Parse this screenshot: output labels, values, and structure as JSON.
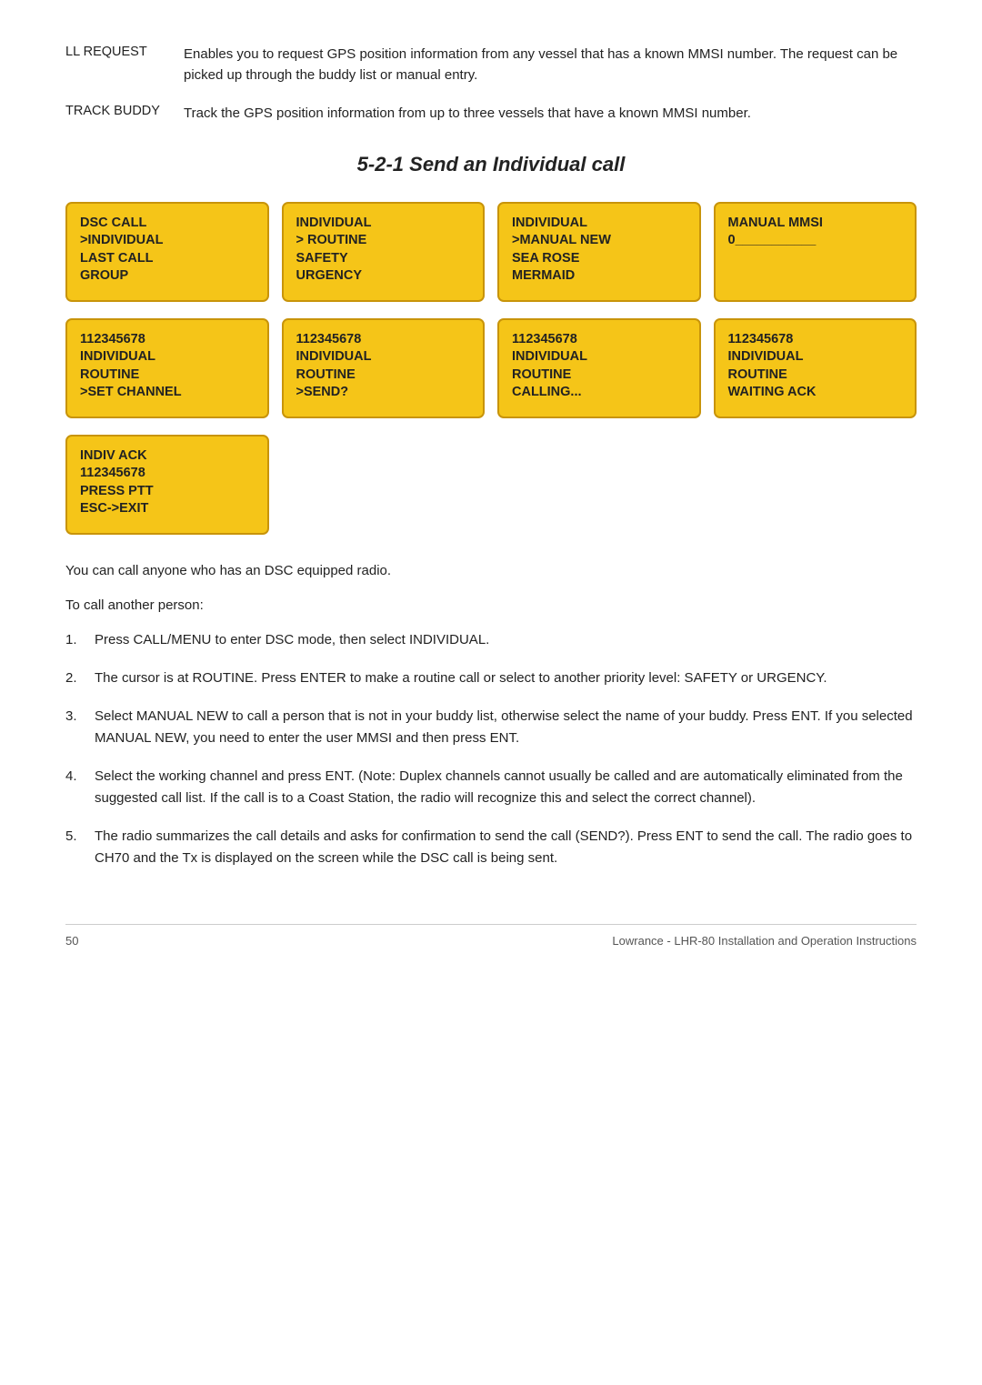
{
  "definitions": [
    {
      "term": "LL REQUEST",
      "body": "Enables you to request GPS position information from any vessel that has a known MMSI number. The request can be picked up through the buddy list or manual entry."
    },
    {
      "term": "TRACK BUDDY",
      "body": "Track the GPS position information from up to three vessels that have a known MMSI number."
    }
  ],
  "section_title": "5-2-1 Send an Individual call",
  "row1": [
    {
      "lines": [
        "DSC CALL",
        ">INDIVIDUAL",
        "LAST CALL",
        "GROUP"
      ]
    },
    {
      "lines": [
        "INDIVIDUAL",
        "> ROUTINE",
        "SAFETY",
        "URGENCY"
      ]
    },
    {
      "lines": [
        "INDIVIDUAL",
        ">MANUAL NEW",
        "SEA ROSE",
        "MERMAID"
      ]
    },
    {
      "lines": [
        "MANUAL MMSI",
        "0___________"
      ]
    }
  ],
  "row2": [
    {
      "lines": [
        "112345678",
        "INDIVIDUAL",
        "ROUTINE",
        ">SET CHANNEL"
      ]
    },
    {
      "lines": [
        "112345678",
        "INDIVIDUAL",
        "ROUTINE",
        ">SEND?"
      ]
    },
    {
      "lines": [
        "112345678",
        "INDIVIDUAL",
        "ROUTINE",
        "CALLING..."
      ]
    },
    {
      "lines": [
        "112345678",
        "INDIVIDUAL",
        "ROUTINE",
        "WAITING ACK"
      ]
    }
  ],
  "row3": [
    {
      "lines": [
        "INDIV ACK",
        "112345678",
        "PRESS PTT",
        "ESC->EXIT"
      ]
    }
  ],
  "body_text_1": "You can call anyone who has an DSC equipped radio.",
  "body_text_2": "To call another person:",
  "list_items": [
    {
      "num": "1.",
      "text": "Press CALL/MENU to enter DSC mode, then select INDIVIDUAL."
    },
    {
      "num": "2.",
      "text": "The cursor is at ROUTINE. Press ENTER to make a routine call or select to another priority level: SAFETY or URGENCY."
    },
    {
      "num": "3.",
      "text": "Select MANUAL NEW to call a person that is not in your buddy list, otherwise select the name of your buddy. Press ENT. If you selected MANUAL NEW, you need to enter the user MMSI and then press ENT."
    },
    {
      "num": "4.",
      "text": "Select the working channel and press ENT. (Note: Duplex channels cannot usually be called and are automatically eliminated from the suggested call list. If the call is to a Coast Station, the radio will recognize this and select the correct channel)."
    },
    {
      "num": "5.",
      "text": "The radio summarizes the call details and asks for confirmation to send the call (SEND?). Press ENT to send the call. The radio goes to CH70 and the Tx is displayed on the screen while the DSC call is being sent."
    }
  ],
  "footer": {
    "page_number": "50",
    "title": "Lowrance - LHR-80 Installation and Operation Instructions"
  }
}
